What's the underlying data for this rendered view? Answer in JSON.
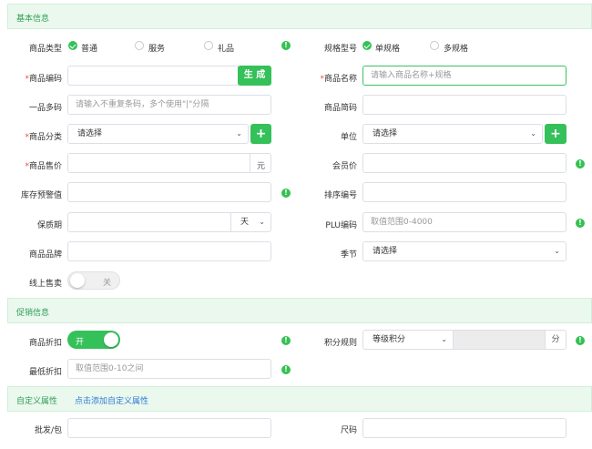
{
  "sections": {
    "basic": "基本信息",
    "promo": "促销信息",
    "custom": "自定义属性",
    "custom_link": "点击添加自定义属性"
  },
  "basic": {
    "type_label": "商品类型",
    "type_options": [
      "普通",
      "服务",
      "礼品"
    ],
    "spec_label": "规格型号",
    "spec_options": [
      "单规格",
      "多规格"
    ],
    "code_label": "商品编码",
    "generate_btn": "生 成",
    "name_label": "商品名称",
    "name_placeholder": "请输入商品名称+规格",
    "multicode_label": "一品多码",
    "multicode_placeholder": "请输入不重复条码，多个使用\"|\"分隔",
    "shortname_label": "商品简码",
    "category_label": "商品分类",
    "category_value": "请选择",
    "unit_label": "单位",
    "unit_value": "请选择",
    "price_label": "商品售价",
    "price_suffix": "元",
    "member_price_label": "会员价",
    "stock_warn_label": "库存预警值",
    "sort_label": "排序编号",
    "shelf_label": "保质期",
    "shelf_unit": "天",
    "plu_label": "PLU编码",
    "plu_placeholder": "取值范围0-4000",
    "brand_label": "商品品牌",
    "season_label": "季节",
    "season_value": "请选择",
    "online_label": "线上售卖",
    "online_toggle": "关"
  },
  "promo": {
    "discount_label": "商品折扣",
    "discount_toggle": "开",
    "points_label": "积分规则",
    "points_value": "等级积分",
    "points_suffix": "分",
    "min_discount_label": "最低折扣",
    "min_discount_placeholder": "取值范围0-10之间"
  },
  "custom": {
    "wholesale_label": "批发/包",
    "size_label": "尺码"
  },
  "icons": {
    "info": "!",
    "plus": "+",
    "chevron": "⌄"
  }
}
